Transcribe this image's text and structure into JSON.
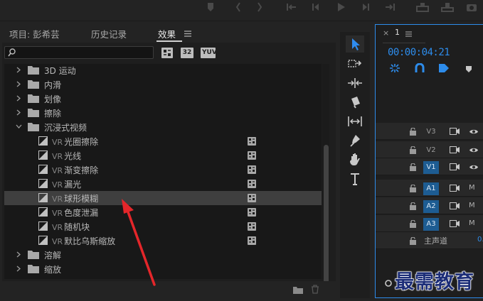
{
  "top_transport_icons": [
    "marker-icon",
    "mark-in-icon",
    "mark-out-icon",
    "go-to-in-icon",
    "step-back-icon",
    "play-icon",
    "step-forward-icon",
    "go-to-out-icon",
    "lift-icon",
    "extract-icon",
    "camera-icon"
  ],
  "effects_panel": {
    "tabs": [
      {
        "label": "项目: 彭希芸",
        "active": false
      },
      {
        "label": "历史记录",
        "active": false
      },
      {
        "label": "效果",
        "active": true
      }
    ],
    "menu_icon": "hamburger-icon",
    "search": {
      "value": "",
      "placeholder": ""
    },
    "badges": [
      "32",
      "YUV"
    ],
    "tree": [
      {
        "label": "3D 运动",
        "type": "folder",
        "expanded": false
      },
      {
        "label": "内滑",
        "type": "folder",
        "expanded": false
      },
      {
        "label": "划像",
        "type": "folder",
        "expanded": false
      },
      {
        "label": "擦除",
        "type": "folder",
        "expanded": false
      },
      {
        "label": "沉浸式视频",
        "type": "folder",
        "expanded": true
      },
      {
        "vr": "VR",
        "label": "光圈擦除",
        "type": "effect"
      },
      {
        "vr": "VR",
        "label": "光线",
        "type": "effect"
      },
      {
        "vr": "VR",
        "label": "渐变擦除",
        "type": "effect"
      },
      {
        "vr": "VR",
        "label": "漏光",
        "type": "effect"
      },
      {
        "vr": "VR",
        "label": "球形模糊",
        "type": "effect",
        "selected": true
      },
      {
        "vr": "VR",
        "label": "色度泄漏",
        "type": "effect"
      },
      {
        "vr": "VR",
        "label": "随机块",
        "type": "effect"
      },
      {
        "vr": "VR",
        "label": "默比乌斯缩放",
        "type": "effect"
      },
      {
        "label": "溶解",
        "type": "folder",
        "expanded": false
      },
      {
        "label": "缩放",
        "type": "folder",
        "expanded": false
      },
      {
        "label": "页面剥落",
        "type": "folder",
        "expanded": false
      }
    ],
    "footer_icons": [
      "new-bin-icon",
      "delete-icon"
    ]
  },
  "tools": [
    "selection-tool",
    "track-select-tool",
    "ripple-edit-tool",
    "razor-tool",
    "slip-tool",
    "pen-tool",
    "hand-tool",
    "type-tool"
  ],
  "timeline": {
    "close": "×",
    "sequence_name": "1",
    "timecode": "00:00:04:21",
    "accent": "#2d8ceb",
    "tracks": [
      {
        "name": "V3",
        "type": "video",
        "targeted": false
      },
      {
        "name": "V2",
        "type": "video",
        "targeted": false
      },
      {
        "name": "V1",
        "type": "video",
        "targeted": true
      },
      {
        "name": "A1",
        "type": "audio",
        "targeted": true,
        "m": "M"
      },
      {
        "name": "A2",
        "type": "audio",
        "targeted": true,
        "m": "M"
      },
      {
        "name": "A3",
        "type": "audio",
        "targeted": true,
        "m": "M"
      }
    ],
    "master": {
      "label": "主声道",
      "value": "0."
    }
  },
  "watermark": "最需教育"
}
